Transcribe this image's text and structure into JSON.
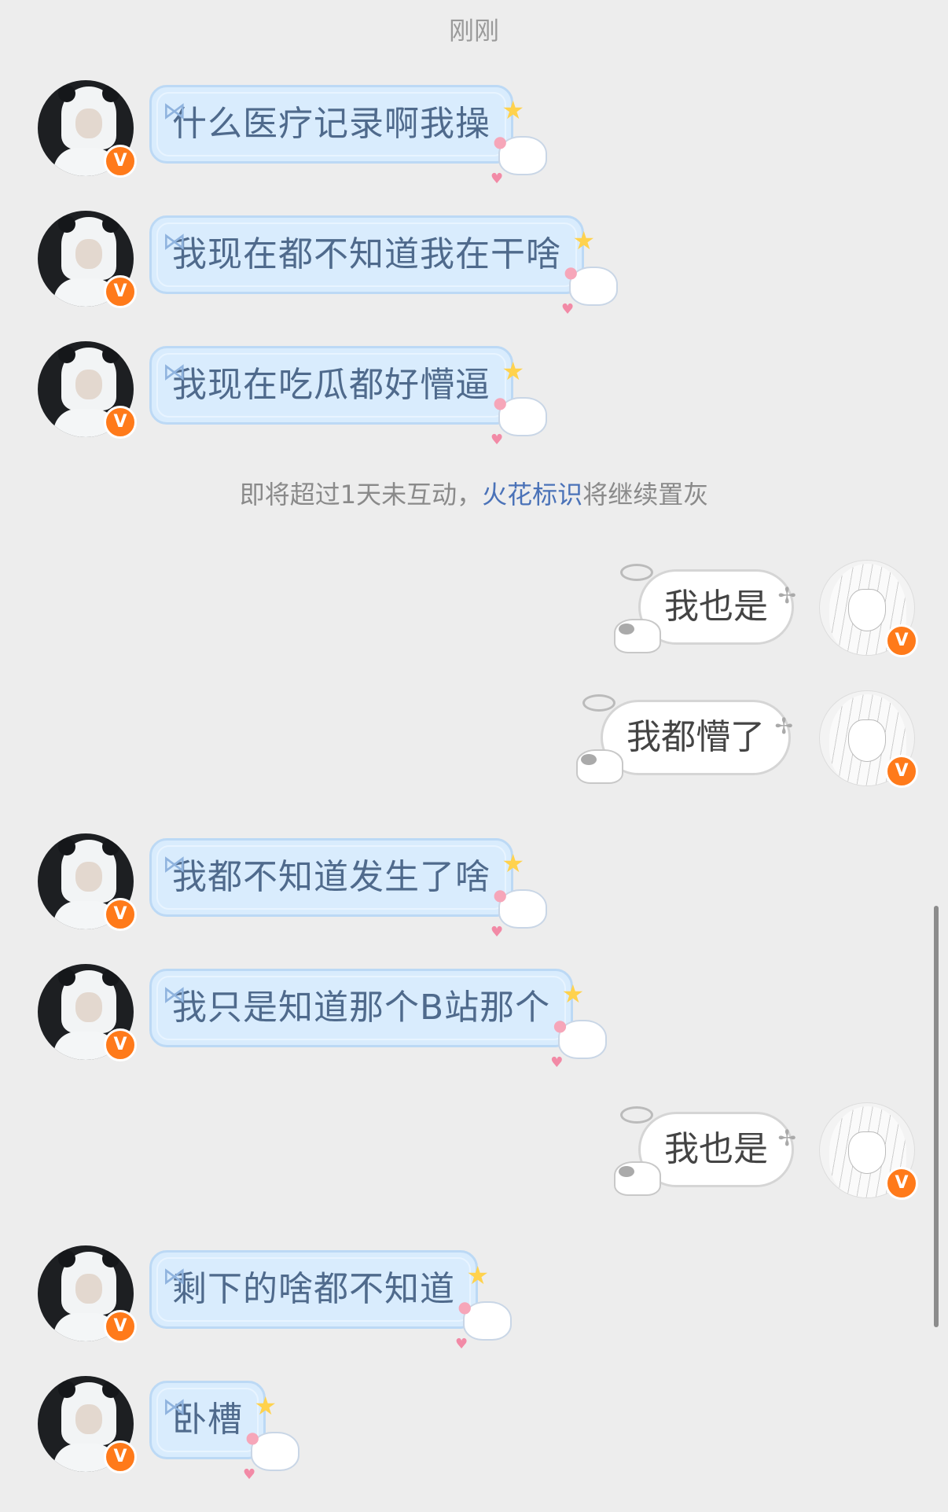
{
  "header": {
    "timestamp": "刚刚"
  },
  "system_notice": {
    "prefix": "即将超过1天未互动，",
    "link": "火花标识",
    "suffix": "将继续置灰"
  },
  "contact": {
    "badge": "V"
  },
  "me": {
    "badge": "V"
  },
  "messages": [
    {
      "from": "contact",
      "text": "什么医疗记录啊我操"
    },
    {
      "from": "contact",
      "text": "我现在都不知道我在干啥"
    },
    {
      "from": "contact",
      "text": "我现在吃瓜都好懵逼"
    },
    {
      "from": "me",
      "text": "我也是"
    },
    {
      "from": "me",
      "text": "我都懵了"
    },
    {
      "from": "contact",
      "text": "我都不知道发生了啥"
    },
    {
      "from": "contact",
      "text": "我只是知道那个B站那个"
    },
    {
      "from": "me",
      "text": "我也是"
    },
    {
      "from": "contact",
      "text": "剩下的啥都不知道"
    },
    {
      "from": "contact",
      "text": "卧槽"
    }
  ],
  "colors": {
    "background": "#ededed",
    "contact_bubble": "#d9ecfd",
    "my_bubble": "#ffffff",
    "badge": "#ff7a1a",
    "link": "#4a72b8"
  }
}
